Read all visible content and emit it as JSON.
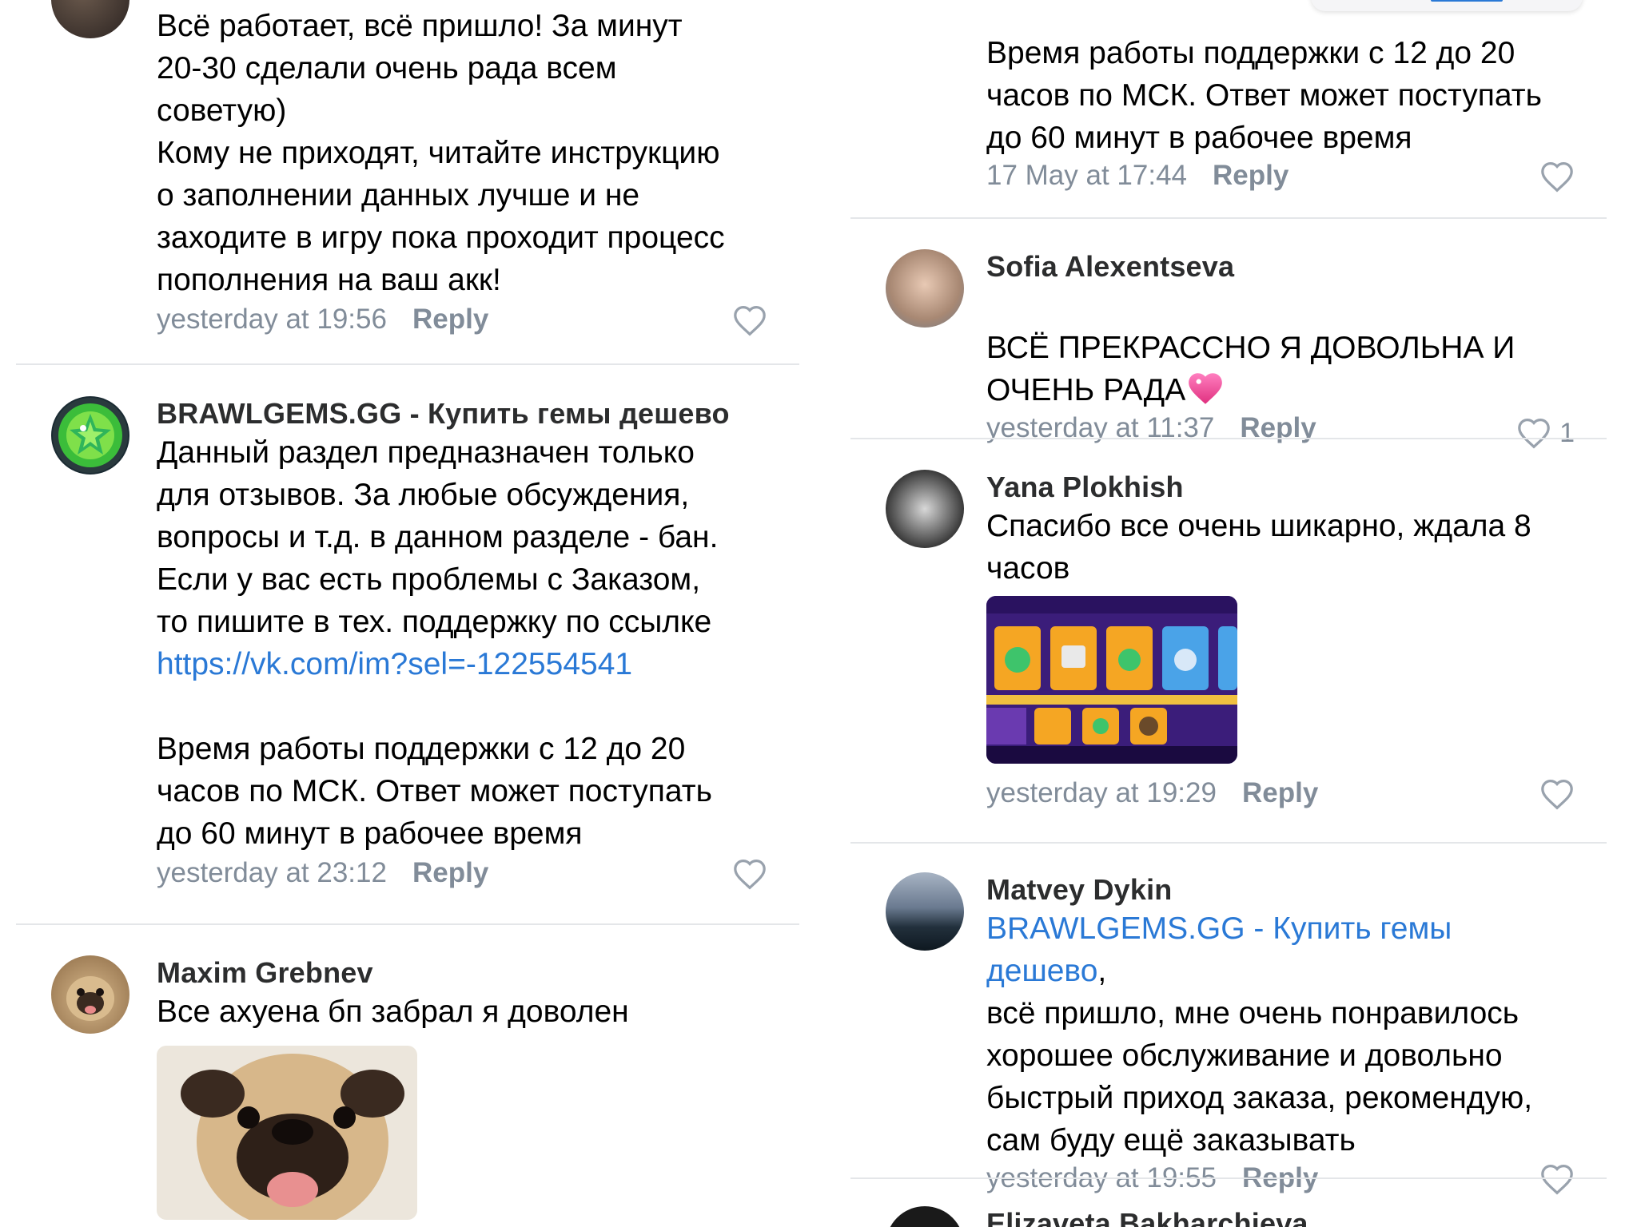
{
  "left": {
    "c1": {
      "text": "Всё работает, всё пришло! За минут\n20-30 сделали очень рада всем\nсоветую)\nКому не приходят, читайте инструкцию\nо заполнении данных лучше и не\nзаходите в игру пока проходит процесс\nпополнения на ваш акк!",
      "time": "yesterday at 19:56",
      "reply": "Reply"
    },
    "c2": {
      "author": "BRAWLGEMS.GG - Купить гемы дешево",
      "text": "Данный раздел предназначен только\nдля отзывов. За любые обсуждения,\nвопросы и т.д. в данном разделе - бан.\nЕсли у вас есть проблемы с Заказом,\nто пишите в тех. поддержку по ссылке",
      "link": "https://vk.com/im?sel=-122554541",
      "text2": "Время работы поддержки с 12 до 20\nчасов по МСК. Ответ может поступать\nдо 60 минут в рабочее время",
      "time": "yesterday at 23:12",
      "reply": "Reply"
    },
    "c3": {
      "author": "Maxim Grebnev",
      "text": "Все ахуена бп забрал я доволен"
    }
  },
  "right": {
    "c0": {
      "text": "Время работы поддержки с 12 до 20\nчасов по МСК. Ответ может поступать\nдо 60 минут в рабочее время",
      "time": "17 May at 17:44",
      "reply": "Reply"
    },
    "c1": {
      "author": "Sofia Alexentseva",
      "text": "ВСЁ ПРЕКРАССНО Я ДОВОЛЬНА И\nОЧЕНЬ РАДА",
      "time": "yesterday at 11:37",
      "reply": "Reply",
      "likes": "1"
    },
    "c2": {
      "author": "Yana Plokhish",
      "text": "Спасибо все очень шикарно, ждала 8\nчасов",
      "time": "yesterday at 19:29",
      "reply": "Reply"
    },
    "c3": {
      "author": "Matvey Dykin",
      "mention": "BRAWLGEMS.GG - Купить гемы дешево",
      "text": ",\nвсё пришло, мне очень понравилось\nхорошее обслуживание и довольно\nбыстрый приход заказа, рекомендую,\nсам буду ещё заказывать",
      "time": "yesterday at 19:55",
      "reply": "Reply"
    },
    "c4": {
      "author": "Elizaveta Bakharchieva"
    }
  },
  "colors": {
    "link": "#2a79d6",
    "meta": "#818c99",
    "divider": "#e4e6e9",
    "author": "#2c2d2e"
  },
  "icons": [
    "heart-outline-icon",
    "sparkling-heart-emoji",
    "gem-logo-avatar"
  ]
}
